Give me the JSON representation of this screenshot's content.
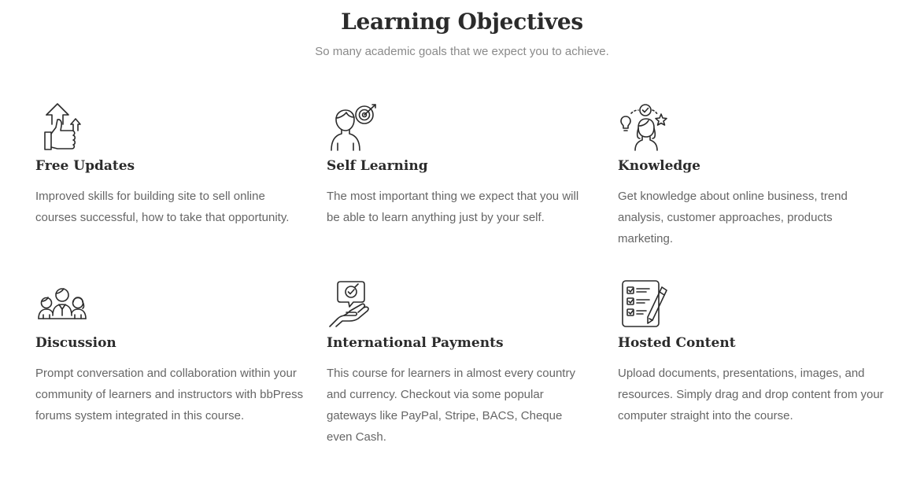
{
  "section": {
    "title": "Learning Objectives",
    "subtitle": "So many academic goals that we expect you to achieve."
  },
  "features": [
    {
      "icon": "thumbs-up-arrows-icon",
      "title": "Free Updates",
      "description": "Improved skills for building site to sell online courses successful, how to take that opportunity."
    },
    {
      "icon": "person-target-icon",
      "title": "Self Learning",
      "description": "The most important thing we expect that you will be able to learn anything just by your self."
    },
    {
      "icon": "woman-ideas-icon",
      "title": "Knowledge",
      "description": "Get knowledge about online business, trend analysis, customer approaches, products marketing."
    },
    {
      "icon": "group-people-icon",
      "title": "Discussion",
      "description": "Prompt conversation and collaboration within your community of learners and instructors with bbPress forums system integrated in this course."
    },
    {
      "icon": "hand-chat-check-icon",
      "title": "International Payments",
      "description": "This course for learners in almost every country and currency. Checkout via some popular gateways like PayPal, Stripe, BACS, Cheque even Cash."
    },
    {
      "icon": "checklist-pencil-icon",
      "title": "Hosted Content",
      "description": "Upload documents, presentations, images, and resources. Simply drag and drop content from your computer straight into the course."
    }
  ]
}
